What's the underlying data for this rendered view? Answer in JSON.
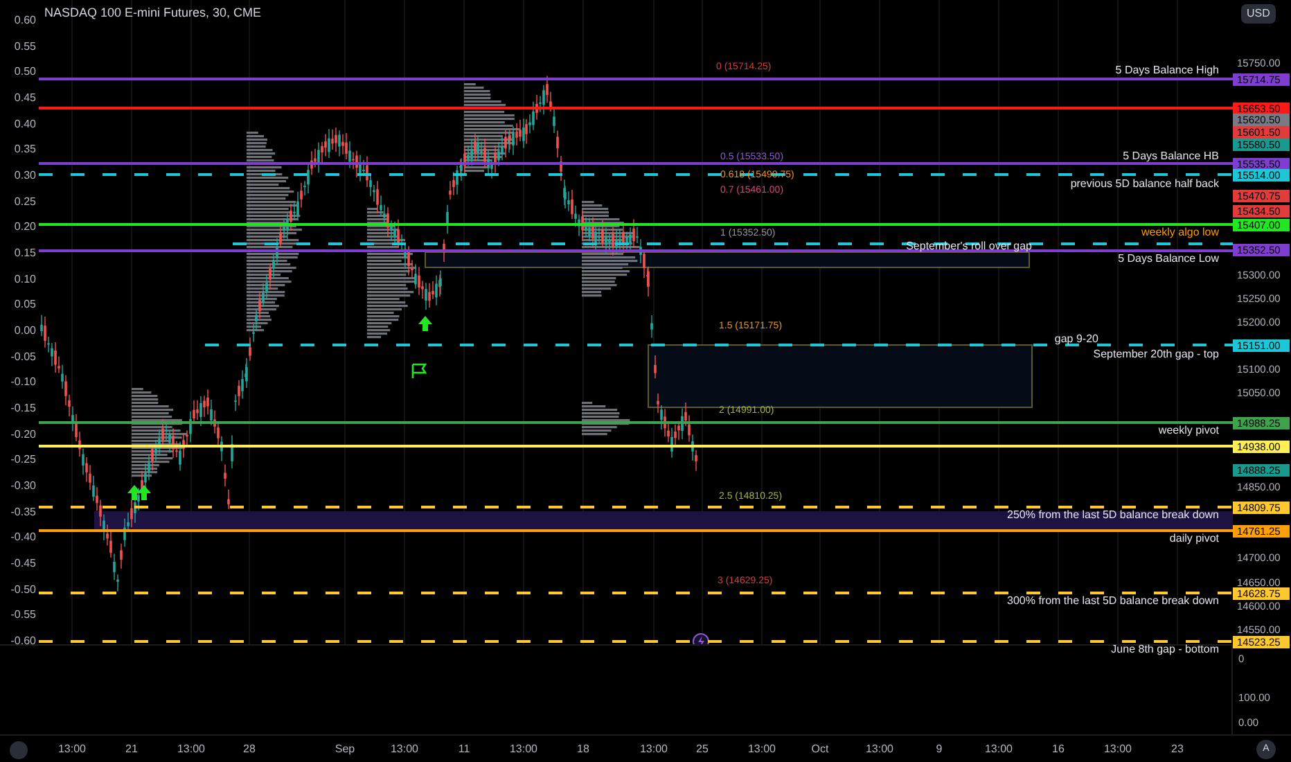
{
  "title": "NASDAQ 100 E-mini Futures, 30, CME",
  "currency_button": "USD",
  "left_axis": [
    "0.60",
    "0.55",
    "0.50",
    "0.45",
    "0.40",
    "0.35",
    "0.30",
    "0.25",
    "0.20",
    "0.15",
    "0.10",
    "0.05",
    "0.00",
    "-0.05",
    "-0.10",
    "-0.15",
    "-0.20",
    "-0.25",
    "-0.30",
    "-0.35",
    "-0.40",
    "-0.45",
    "-0.50",
    "-0.55",
    "-0.60"
  ],
  "levels": [
    {
      "kind": "solid",
      "color": "#7e3fd0"
    },
    {
      "kind": "solid",
      "color": "#ff1a1a"
    },
    {
      "kind": "solid",
      "color": "#7e3fd0"
    },
    {
      "kind": "dashed",
      "color": "#1fc6d6"
    },
    {
      "kind": "solid",
      "color": "#22e622"
    },
    {
      "kind": "dashed",
      "color": "#1fc6d6"
    },
    {
      "kind": "solid",
      "color": "#7e3fd0"
    },
    {
      "kind": "dashed",
      "color": "#1fc6d6"
    },
    {
      "kind": "solid",
      "color": "#3fa34d"
    },
    {
      "kind": "solid",
      "color": "#ffee55"
    },
    {
      "kind": "dashed",
      "color": "#ffc82e"
    },
    {
      "kind": "solid",
      "color": "#ff9f0a"
    },
    {
      "kind": "dashed",
      "color": "#ffc82e"
    },
    {
      "kind": "dashed",
      "color": "#ffc82e"
    }
  ],
  "level_labels": [
    {
      "text": "5 Days Balance High",
      "color": "#e0e3eb"
    },
    {
      "text": "5 Days Balance HB",
      "color": "#e0e3eb"
    },
    {
      "text": "previous 5D balance half back",
      "color": "#e0e3eb"
    },
    {
      "text": "weekly algo low",
      "color": "#ff9800"
    },
    {
      "text": "September's roll over gap",
      "color": "#e0e3eb"
    },
    {
      "text": "5 Days Balance Low",
      "color": "#e0e3eb"
    },
    {
      "text": "gap 9-20",
      "color": "#e0e3eb"
    },
    {
      "text": "September 20th gap - top",
      "color": "#e0e3eb"
    },
    {
      "text": "weekly pivot",
      "color": "#e0e3eb"
    },
    {
      "text": "250% from the last 5D balance break down",
      "color": "#e0e3eb"
    },
    {
      "text": "daily pivot",
      "color": "#e0e3eb"
    },
    {
      "text": "300% from the last 5D balance break down",
      "color": "#e0e3eb"
    },
    {
      "text": "June 8th gap - bottom",
      "color": "#e0e3eb"
    }
  ],
  "fib_labels": [
    {
      "text": "0 (15714.25)",
      "color": "#d93a3a"
    },
    {
      "text": "0.5 (15533.50)",
      "color": "#8a5cd6"
    },
    {
      "text": "0.618 (15490.75)",
      "color": "#e8922a"
    },
    {
      "text": "0.7 (15461.00)",
      "color": "#d9457a"
    },
    {
      "text": "1 (15352.50)",
      "color": "#9598a1"
    },
    {
      "text": "1.5 (15171.75)",
      "color": "#e8922a"
    },
    {
      "text": "2 (14991.00)",
      "color": "#a7b03c"
    },
    {
      "text": "2.5 (14810.25)",
      "color": "#a7b03c"
    },
    {
      "text": "3 (14629.25)",
      "color": "#d93a3a"
    }
  ],
  "price_ticks": [
    "15750.00",
    "15300.00",
    "15250.00",
    "15200.00",
    "15100.00",
    "15050.00",
    "14850.00",
    "14700.00",
    "14650.00",
    "14600.00",
    "14550.00"
  ],
  "price_tags": [
    {
      "text": "15714.75",
      "color": "#7e3fd0"
    },
    {
      "text": "15653.50",
      "color": "#ff1a1a"
    },
    {
      "text": "15620.50",
      "color": "#787b86"
    },
    {
      "text": "15601.50",
      "color": "#e03c3c"
    },
    {
      "text": "15580.50",
      "color": "#1a9a8e"
    },
    {
      "text": "15535.50",
      "color": "#7e3fd0"
    },
    {
      "text": "15514.00",
      "color": "#1fc6d6"
    },
    {
      "text": "15470.75",
      "color": "#e03c3c"
    },
    {
      "text": "15434.50",
      "color": "#e03c3c"
    },
    {
      "text": "15407.00",
      "color": "#22e622"
    },
    {
      "text": "15352.50",
      "color": "#7e3fd0"
    },
    {
      "text": "15151.00",
      "color": "#1fc6d6"
    },
    {
      "text": "14988.25",
      "color": "#3fa34d"
    },
    {
      "text": "14938.00",
      "color": "#ffee55"
    },
    {
      "text": "14888.25",
      "color": "#1a9a8e"
    },
    {
      "text": "14809.75",
      "color": "#ffc82e"
    },
    {
      "text": "14761.25",
      "color": "#ff9f0a"
    },
    {
      "text": "14628.75",
      "color": "#ffc82e"
    },
    {
      "text": "14523.25",
      "color": "#ffc82e"
    }
  ],
  "lower_pane_ticks": [
    "0",
    "100.00",
    "0.00"
  ],
  "time_axis": [
    "13:00",
    "21",
    "13:00",
    "28",
    "Sep",
    "13:00",
    "11",
    "13:00",
    "18",
    "13:00",
    "25",
    "13:00",
    "Oct",
    "13:00",
    "9",
    "13:00",
    "16",
    "13:00",
    "23"
  ],
  "auto_scale_button": "A"
}
